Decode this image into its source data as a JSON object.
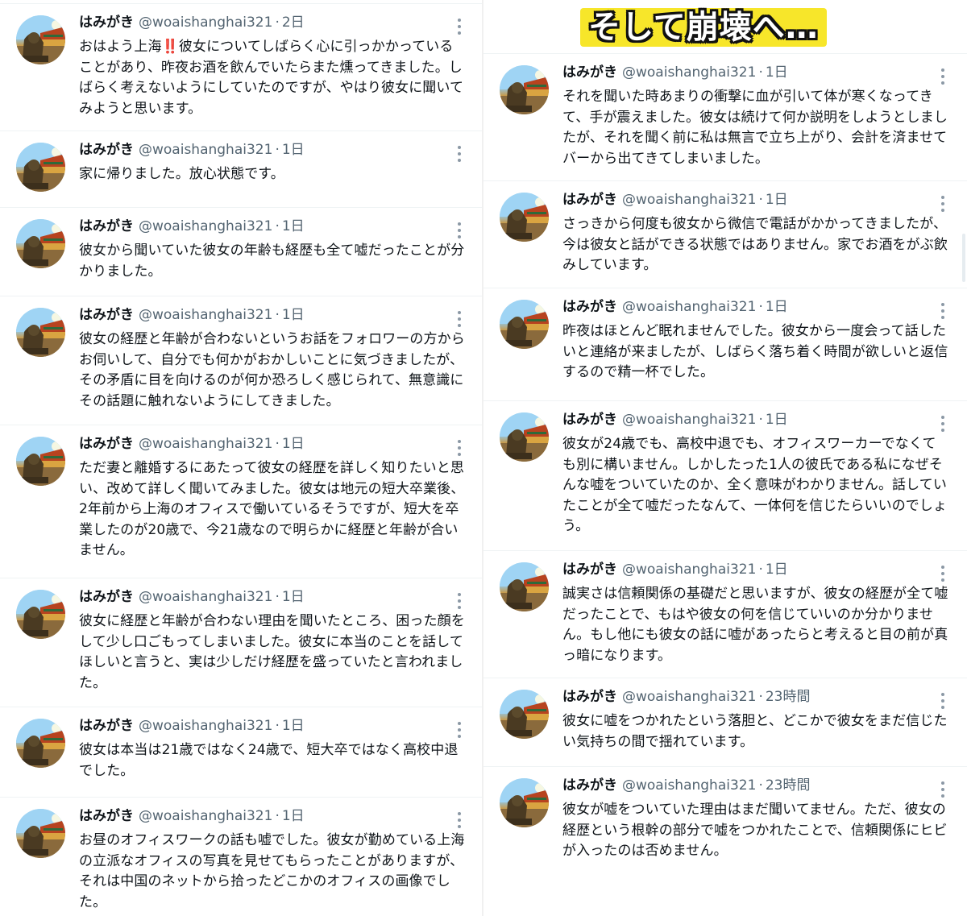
{
  "banner": "そして崩壊へ…",
  "author": {
    "name": "はみがき",
    "handle": "@woaishanghai321",
    "separator": "·"
  },
  "icons": {
    "more": "more-options-icon",
    "avatar": "lion-statue-avatar"
  },
  "left_tweets": [
    {
      "time": "2日",
      "text": "おはよう上海‼️彼女についてしばらく心に引っかかっている\nことがあり、昨夜お酒を飲んでいたらまた燻ってきました。し\nばらく考えないようにしていたのですが、やはり彼女に聞いて\nみようと思います。"
    },
    {
      "time": "1日",
      "text": "家に帰りました。放心状態です。"
    },
    {
      "time": "1日",
      "text": "彼女から聞いていた彼女の年齢も経歴も全て嘘だったことが分\nかりました。"
    },
    {
      "time": "1日",
      "text": "彼女の経歴と年齢が合わないというお話をフォロワーの方から\nお伺いして、自分でも何かがおかしいことに気づきましたが、\nその矛盾に目を向けるのが何か恐ろしく感じられて、無意識に\nその話題に触れないようにしてきました。"
    },
    {
      "time": "1日",
      "text": "ただ妻と離婚するにあたって彼女の経歴を詳しく知りたいと思\nい、改めて詳しく聞いてみました。彼女は地元の短大卒業後、\n2年前から上海のオフィスで働いているそうですが、短大を卒\n業したのが20歳で、今21歳なので明らかに経歴と年齢が合い\nません。"
    },
    {
      "time": "1日",
      "text": "彼女に経歴と年齢が合わない理由を聞いたところ、困った顔を\nして少し口ごもってしまいました。彼女に本当のことを話して\nほしいと言うと、実は少しだけ経歴を盛っていたと言われまし\nた。"
    },
    {
      "time": "1日",
      "text": "彼女は本当は21歳ではなく24歳で、短大卒ではなく高校中退\nでした。"
    },
    {
      "time": "1日",
      "text": "お昼のオフィスワークの話も嘘でした。彼女が勤めている上海\nの立派なオフィスの写真を見せてもらったことがありますが、\nそれは中国のネットから拾ったどこかのオフィスの画像でし\nた。"
    }
  ],
  "right_tweets": [
    {
      "time": "1日",
      "text": "それを聞いた時あまりの衝撃に血が引いて体が寒くなってき\nて、手が震えました。彼女は続けて何か説明をしようとしまし\nたが、それを聞く前に私は無言で立ち上がり、会計を済ませて\nバーから出てきてしまいました。"
    },
    {
      "time": "1日",
      "text": "さっきから何度も彼女から微信で電話がかかってきましたが、\n今は彼女と話ができる状態ではありません。家でお酒をがぶ飲\nみしています。"
    },
    {
      "time": "1日",
      "text": "昨夜はほとんど眠れませんでした。彼女から一度会って話した\nいと連絡が来ましたが、しばらく落ち着く時間が欲しいと返信\nするので精一杯でした。"
    },
    {
      "time": "1日",
      "text": "彼女が24歳でも、高校中退でも、オフィスワーカーでなくて\nも別に構いません。しかしたった1人の彼氏である私になぜそ\nんな嘘をついていたのか、全く意味がわかりません。話してい\nたことが全て嘘だったなんて、一体何を信じたらいいのでしょ\nう。"
    },
    {
      "time": "1日",
      "text": "誠実さは信頼関係の基礎だと思いますが、彼女の経歴が全て嘘\nだったことで、もはや彼女の何を信じていいのか分かりませ\nん。もし他にも彼女の話に嘘があったらと考えると目の前が真\nっ暗になります。"
    },
    {
      "time": "23時間",
      "text": "彼女に嘘をつかれたという落胆と、どこかで彼女をまだ信じた\nい気持ちの間で揺れています。"
    },
    {
      "time": "23時間",
      "text": "彼女が嘘をついていた理由はまだ聞いてません。ただ、彼女の\n経歴という根幹の部分で嘘をつかれたことで、信頼関係にヒビ\nが入ったのは否めません。"
    }
  ]
}
